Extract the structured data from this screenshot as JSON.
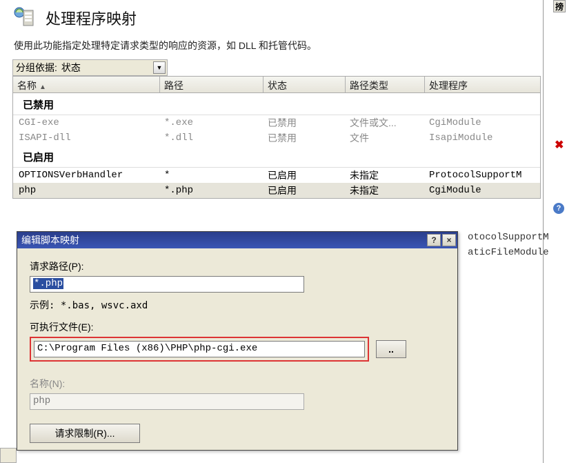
{
  "header": {
    "title": "处理程序映射"
  },
  "description": "使用此功能指定处理特定请求类型的响应的资源，如 DLL 和托管代码。",
  "groupby": {
    "label": "分组依据:",
    "value": "状态"
  },
  "columns": {
    "name": "名称",
    "path": "路径",
    "state": "状态",
    "ptype": "路径类型",
    "handler": "处理程序"
  },
  "groups": {
    "disabled_label": "已禁用",
    "enabled_label": "已启用"
  },
  "rows_disabled": [
    {
      "name": "CGI-exe",
      "path": "*.exe",
      "state": "已禁用",
      "ptype": "文件或文...",
      "handler": "CgiModule"
    },
    {
      "name": "ISAPI-dll",
      "path": "*.dll",
      "state": "已禁用",
      "ptype": "文件",
      "handler": "IsapiModule"
    }
  ],
  "rows_enabled": [
    {
      "name": "OPTIONSVerbHandler",
      "path": "*",
      "state": "已启用",
      "ptype": "未指定",
      "handler": "ProtocolSupportM"
    },
    {
      "name": "php",
      "path": "*.php",
      "state": "已启用",
      "ptype": "未指定",
      "handler": "CgiModule"
    }
  ],
  "peek_rows": [
    {
      "handler": "otocolSupportM"
    },
    {
      "handler": "aticFileModule"
    }
  ],
  "dialog": {
    "title": "编辑脚本映射",
    "request_path_label": "请求路径(P):",
    "request_path_value": "*.php",
    "example": "示例: *.bas, wsvc.axd",
    "exec_label": "可执行文件(E):",
    "exec_value": "C:\\Program Files (x86)\\PHP\\php-cgi.exe",
    "browse_label": "..",
    "name_label": "名称(N):",
    "name_value": "php",
    "restrict_label": "请求限制(R)...",
    "help_label": "?",
    "close_label": "×"
  },
  "right": {
    "tab_char": "搒"
  }
}
